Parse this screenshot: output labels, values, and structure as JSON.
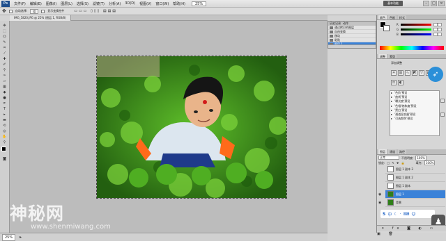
{
  "app": {
    "logo": "Ps"
  },
  "menubar": {
    "items": [
      "文件(F)",
      "编辑(E)",
      "图像(I)",
      "图层(L)",
      "选择(S)",
      "滤镜(T)",
      "分析(A)",
      "3D(D)",
      "视图(V)",
      "窗口(W)",
      "帮助(H)"
    ],
    "zoom": "25%",
    "workspace": "基本功能"
  },
  "options": {
    "mode_label": "自动选择:",
    "mode_value": "组",
    "transform_label": "显示变换控件"
  },
  "document": {
    "tab_title": "IMG_5820.JPG @ 25% (图层 1, RGB/8)"
  },
  "history": {
    "tabs": [
      "历史记录",
      "动作"
    ],
    "rows": [
      "通过拷贝的图层",
      "自由变换",
      "移动",
      "粘贴",
      "图层 1"
    ],
    "selected_index": 4
  },
  "color_panel": {
    "tabs": [
      "颜色",
      "色板",
      "样式"
    ],
    "channels": [
      {
        "label": "R",
        "value": "0",
        "gradient": "linear-gradient(90deg,#000,#f00)"
      },
      {
        "label": "G",
        "value": "0",
        "gradient": "linear-gradient(90deg,#000,#0f0)"
      },
      {
        "label": "B",
        "value": "0",
        "gradient": "linear-gradient(90deg,#000,#00f)"
      }
    ]
  },
  "adjustments": {
    "tabs": [
      "调整",
      "蒙版"
    ],
    "title": "添加调整",
    "presets": [
      "'色阶'预设",
      "'曲线'预设",
      "'曝光度'预设",
      "'色相/饱和度'预设",
      "'黑白'预设",
      "'通道混合器'预设",
      "'可选颜色'预设"
    ]
  },
  "layers": {
    "tabs": [
      "图层",
      "通道",
      "路径"
    ],
    "blend_mode": "正常",
    "opacity_label": "不透明度:",
    "opacity_value": "100%",
    "lock_label": "锁定:",
    "fill_label": "填充:",
    "fill_value": "100%",
    "items": [
      {
        "name": "图层 1 副本 3",
        "thumb": "blank",
        "visible": false
      },
      {
        "name": "图层 1 副本 2",
        "thumb": "blank",
        "visible": false
      },
      {
        "name": "图层 1 副本",
        "thumb": "blank",
        "visible": false
      },
      {
        "name": "图层 1",
        "thumb": "image",
        "visible": true
      },
      {
        "name": "背景",
        "thumb": "image",
        "visible": true
      }
    ],
    "selected_index": 3
  },
  "status": {
    "zoom": "25%"
  },
  "watermark": {
    "big": "神秘网",
    "small": "www.shenmiwang.com"
  },
  "colors": {
    "selection": "#3b82d8",
    "accent": "#1f4e8c"
  }
}
